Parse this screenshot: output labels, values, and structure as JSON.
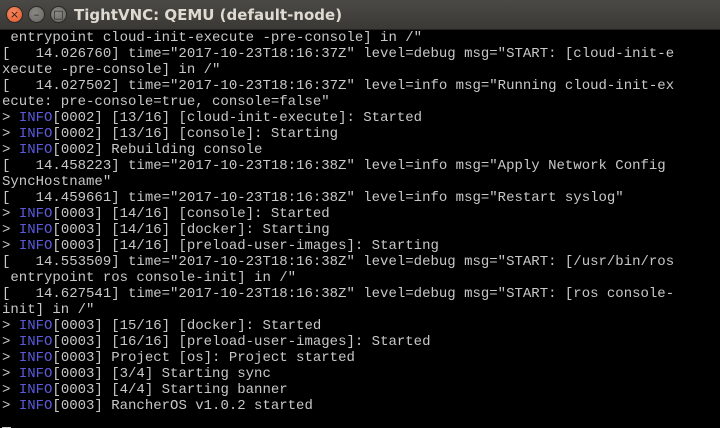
{
  "window": {
    "title": "TightVNC: QEMU (default-node)",
    "controls": {
      "close": "×",
      "minimize": "–",
      "maximize": "□"
    }
  },
  "terminal": {
    "lines": [
      {
        "prefix": " entrypoint cloud-init-execute -pre-console] in /\""
      },
      {
        "prefix": "[   14.026760] time=\"2017-10-23T18:16:37Z\" level=debug msg=\"START: [cloud-init-e"
      },
      {
        "prefix": "xecute -pre-console] in /\""
      },
      {
        "prefix": "[   14.027502] time=\"2017-10-23T18:16:37Z\" level=info msg=\"Running cloud-init-ex"
      },
      {
        "prefix": "ecute: pre-console=true, console=false\""
      },
      {
        "prefix": "> ",
        "tag": "INFO",
        "rest": "[0002] [13/16] [cloud-init-execute]: Started"
      },
      {
        "prefix": "> ",
        "tag": "INFO",
        "rest": "[0002] [13/16] [console]: Starting"
      },
      {
        "prefix": "> ",
        "tag": "INFO",
        "rest": "[0002] Rebuilding console"
      },
      {
        "prefix": "[   14.458223] time=\"2017-10-23T18:16:38Z\" level=info msg=\"Apply Network Config"
      },
      {
        "prefix": "SyncHostname\""
      },
      {
        "prefix": "[   14.459661] time=\"2017-10-23T18:16:38Z\" level=info msg=\"Restart syslog\""
      },
      {
        "prefix": "> ",
        "tag": "INFO",
        "rest": "[0003] [14/16] [console]: Started"
      },
      {
        "prefix": "> ",
        "tag": "INFO",
        "rest": "[0003] [14/16] [docker]: Starting"
      },
      {
        "prefix": "> ",
        "tag": "INFO",
        "rest": "[0003] [14/16] [preload-user-images]: Starting"
      },
      {
        "prefix": "[   14.553509] time=\"2017-10-23T18:16:38Z\" level=debug msg=\"START: [/usr/bin/ros"
      },
      {
        "prefix": " entrypoint ros console-init] in /\""
      },
      {
        "prefix": "[   14.627541] time=\"2017-10-23T18:16:38Z\" level=debug msg=\"START: [ros console-"
      },
      {
        "prefix": "init] in /\""
      },
      {
        "prefix": "> ",
        "tag": "INFO",
        "rest": "[0003] [15/16] [docker]: Started"
      },
      {
        "prefix": "> ",
        "tag": "INFO",
        "rest": "[0003] [16/16] [preload-user-images]: Started"
      },
      {
        "prefix": "> ",
        "tag": "INFO",
        "rest": "[0003] Project [os]: Project started"
      },
      {
        "prefix": "> ",
        "tag": "INFO",
        "rest": "[0003] [3/4] Starting sync"
      },
      {
        "prefix": "> ",
        "tag": "INFO",
        "rest": "[0003] [4/4] Starting banner"
      },
      {
        "prefix": "> ",
        "tag": "INFO",
        "rest": "[0003] RancherOS v1.0.2 started"
      },
      {
        "prefix": ""
      }
    ]
  },
  "colors": {
    "background": "#000000",
    "text": "#c8c8c8",
    "info_tag": "#5b5bdc",
    "titlebar": "#3c3b37",
    "close_button": "#e95420"
  }
}
